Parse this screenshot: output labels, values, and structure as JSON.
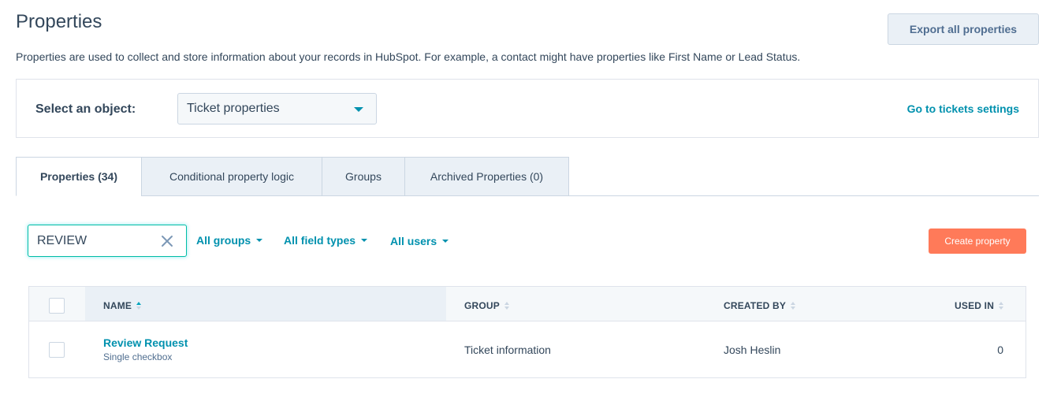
{
  "header": {
    "title": "Properties",
    "export_label": "Export all properties",
    "description": "Properties are used to collect and store information about your records in HubSpot. For example, a contact might have properties like First Name or Lead Status."
  },
  "object_selector": {
    "label": "Select an object:",
    "selected": "Ticket properties",
    "settings_link": "Go to tickets settings"
  },
  "tabs": [
    {
      "label": "Properties (34)",
      "active": true
    },
    {
      "label": "Conditional property logic",
      "active": false
    },
    {
      "label": "Groups",
      "active": false
    },
    {
      "label": "Archived Properties (0)",
      "active": false
    }
  ],
  "filters": {
    "search_value": "REVIEW",
    "groups": "All groups",
    "field_types": "All field types",
    "users": "All users",
    "create_label": "Create property"
  },
  "table": {
    "columns": {
      "name": "NAME",
      "group": "GROUP",
      "created_by": "CREATED BY",
      "used_in": "USED IN"
    },
    "rows": [
      {
        "name": "Review Request",
        "type": "Single checkbox",
        "group": "Ticket information",
        "created_by": "Josh Heslin",
        "used_in": "0"
      }
    ]
  },
  "colors": {
    "accent": "#0091ae",
    "primary_button": "#ff7a59",
    "text": "#33475b"
  }
}
